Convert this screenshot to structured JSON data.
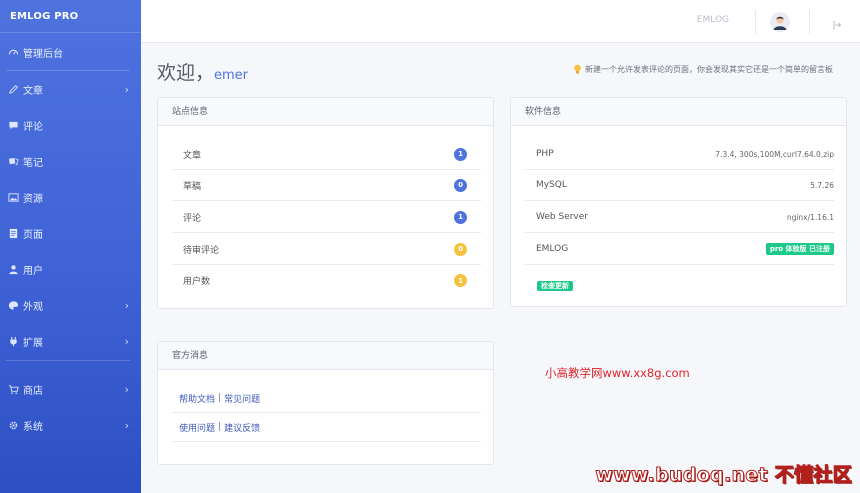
{
  "sidebar": {
    "brand": "EMLOG PRO",
    "items": [
      {
        "label": "管理后台",
        "icon": "gauge-icon"
      },
      {
        "label": "文章",
        "icon": "pencil-icon",
        "has_submenu": true
      },
      {
        "label": "评论",
        "icon": "comment-icon"
      },
      {
        "label": "笔记",
        "icon": "note-icon"
      },
      {
        "label": "资源",
        "icon": "image-icon"
      },
      {
        "label": "页面",
        "icon": "page-icon"
      },
      {
        "label": "用户",
        "icon": "user-icon"
      },
      {
        "label": "外观",
        "icon": "palette-icon",
        "has_submenu": true
      },
      {
        "label": "扩展",
        "icon": "plug-icon",
        "has_submenu": true
      },
      {
        "label": "商店",
        "icon": "cart-icon",
        "has_submenu": true
      },
      {
        "label": "系统",
        "icon": "gear-icon",
        "has_submenu": true
      }
    ]
  },
  "topbar": {
    "site_name": "EMLOG"
  },
  "main": {
    "welcome": "欢迎，",
    "username": "emer",
    "notice": "新建一个允许发表评论的页面，你会发现其实它还是一个简单的留言板"
  },
  "site_info": {
    "title": "站点信息",
    "rows": [
      {
        "label": "文章",
        "count": "1",
        "color": "#4e73df"
      },
      {
        "label": "草稿",
        "count": "0",
        "color": "#4e73df"
      },
      {
        "label": "评论",
        "count": "1",
        "color": "#4e73df"
      },
      {
        "label": "待审评论",
        "count": "0",
        "color": "#f6c23e"
      },
      {
        "label": "用户数",
        "count": "1",
        "color": "#f6c23e"
      }
    ]
  },
  "software_info": {
    "title": "软件信息",
    "rows": [
      {
        "label": "PHP",
        "value": "7.3.4, 300s,100M,curl7.64.0,zip"
      },
      {
        "label": "MySQL",
        "value": "5.7.26"
      },
      {
        "label": "Web Server",
        "value": "nginx/1.16.1"
      },
      {
        "label": "EMLOG",
        "value": "pro 体验版 已注册"
      }
    ],
    "check_update": "检查更新"
  },
  "official": {
    "title": "官方消息",
    "links": [
      {
        "a": "帮助文档",
        "sep": "|",
        "b": "常见问题"
      },
      {
        "a": "使用问题",
        "sep": "|",
        "b": "建议反馈"
      }
    ]
  },
  "overlay": {
    "red_text": "小高教学网www.xx8g.com",
    "watermark": "www.budoq.net 不懂社区"
  },
  "colors": {
    "accent": "#4e73df",
    "warning": "#f6c23e",
    "success": "#1cc88a"
  }
}
